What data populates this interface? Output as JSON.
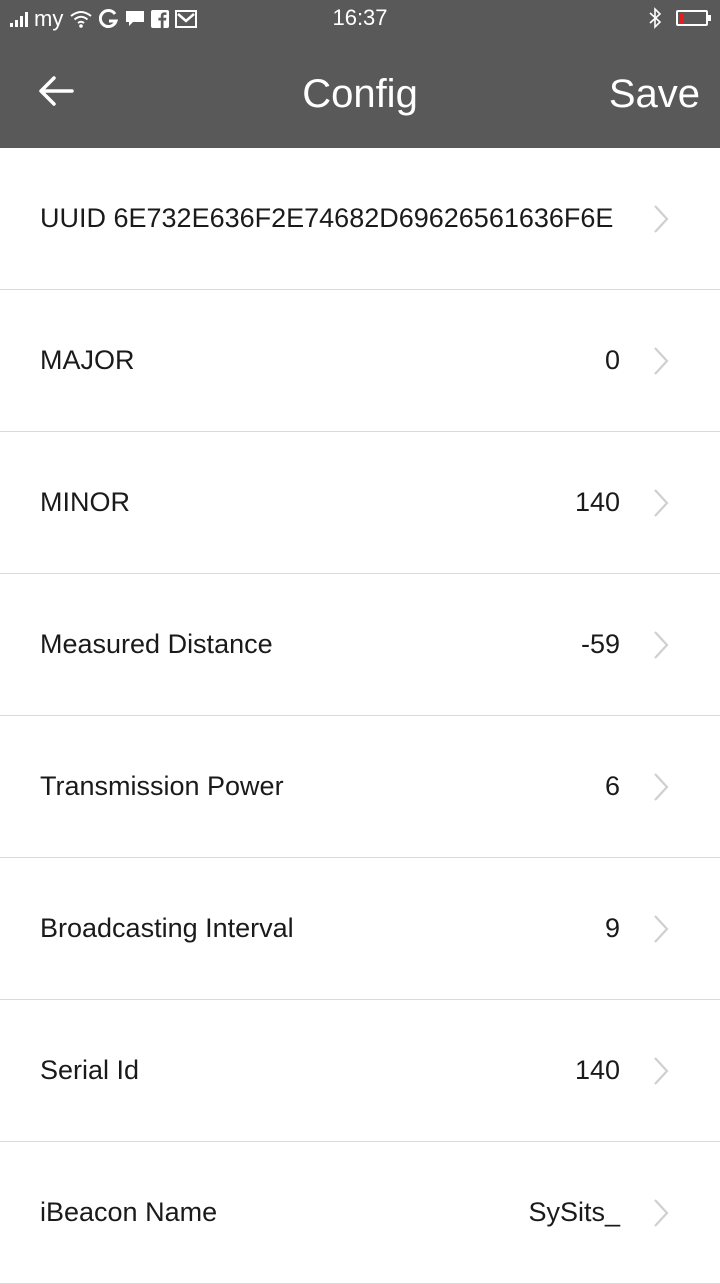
{
  "status_bar": {
    "carrier": "my",
    "time": "16:37",
    "icons": [
      "signal-icon",
      "wifi-icon",
      "g-app-icon",
      "chat-icon",
      "facebook-icon",
      "mail-icon",
      "bluetooth-icon",
      "battery-icon"
    ],
    "battery_level": 0.15,
    "battery_color": "#e02020"
  },
  "app_bar": {
    "back_icon": "back-arrow-icon",
    "title": "Config",
    "save_label": "Save",
    "background": "#595959"
  },
  "rows": [
    {
      "label": "UUID 6E732E636F2E74682D69626561636F6E",
      "value": ""
    },
    {
      "label": "MAJOR",
      "value": "0"
    },
    {
      "label": "MINOR",
      "value": "140"
    },
    {
      "label": "Measured Distance",
      "value": "-59"
    },
    {
      "label": "Transmission Power",
      "value": "6"
    },
    {
      "label": "Broadcasting Interval",
      "value": "9"
    },
    {
      "label": "Serial Id",
      "value": "140"
    },
    {
      "label": "iBeacon Name",
      "value": "SySits_"
    }
  ]
}
